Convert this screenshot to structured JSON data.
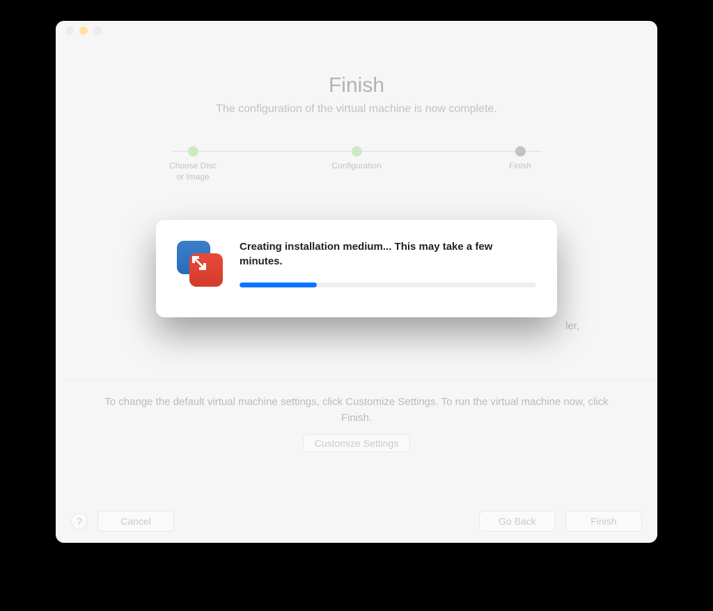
{
  "header": {
    "title": "Finish",
    "subtitle": "The configuration of the virtual machine is now complete."
  },
  "stepper": {
    "steps": [
      {
        "label": "Choose Disc\nor Image",
        "state": "done"
      },
      {
        "label": "Configuration",
        "state": "done"
      },
      {
        "label": "Finish",
        "state": "current"
      }
    ]
  },
  "background_partial_text": "ler,",
  "footer": {
    "hint": "To change the default virtual machine settings, click Customize Settings. To run the virtual machine now, click Finish.",
    "customize_label": "Customize Settings"
  },
  "buttons": {
    "help": "?",
    "cancel": "Cancel",
    "go_back": "Go Back",
    "finish": "Finish"
  },
  "dialog": {
    "message": "Creating installation medium... This may take a few minutes.",
    "progress_percent": 26
  },
  "colors": {
    "accent_blue": "#0a73ff",
    "step_done": "#8fd17c",
    "step_current": "#7a7a7a"
  }
}
